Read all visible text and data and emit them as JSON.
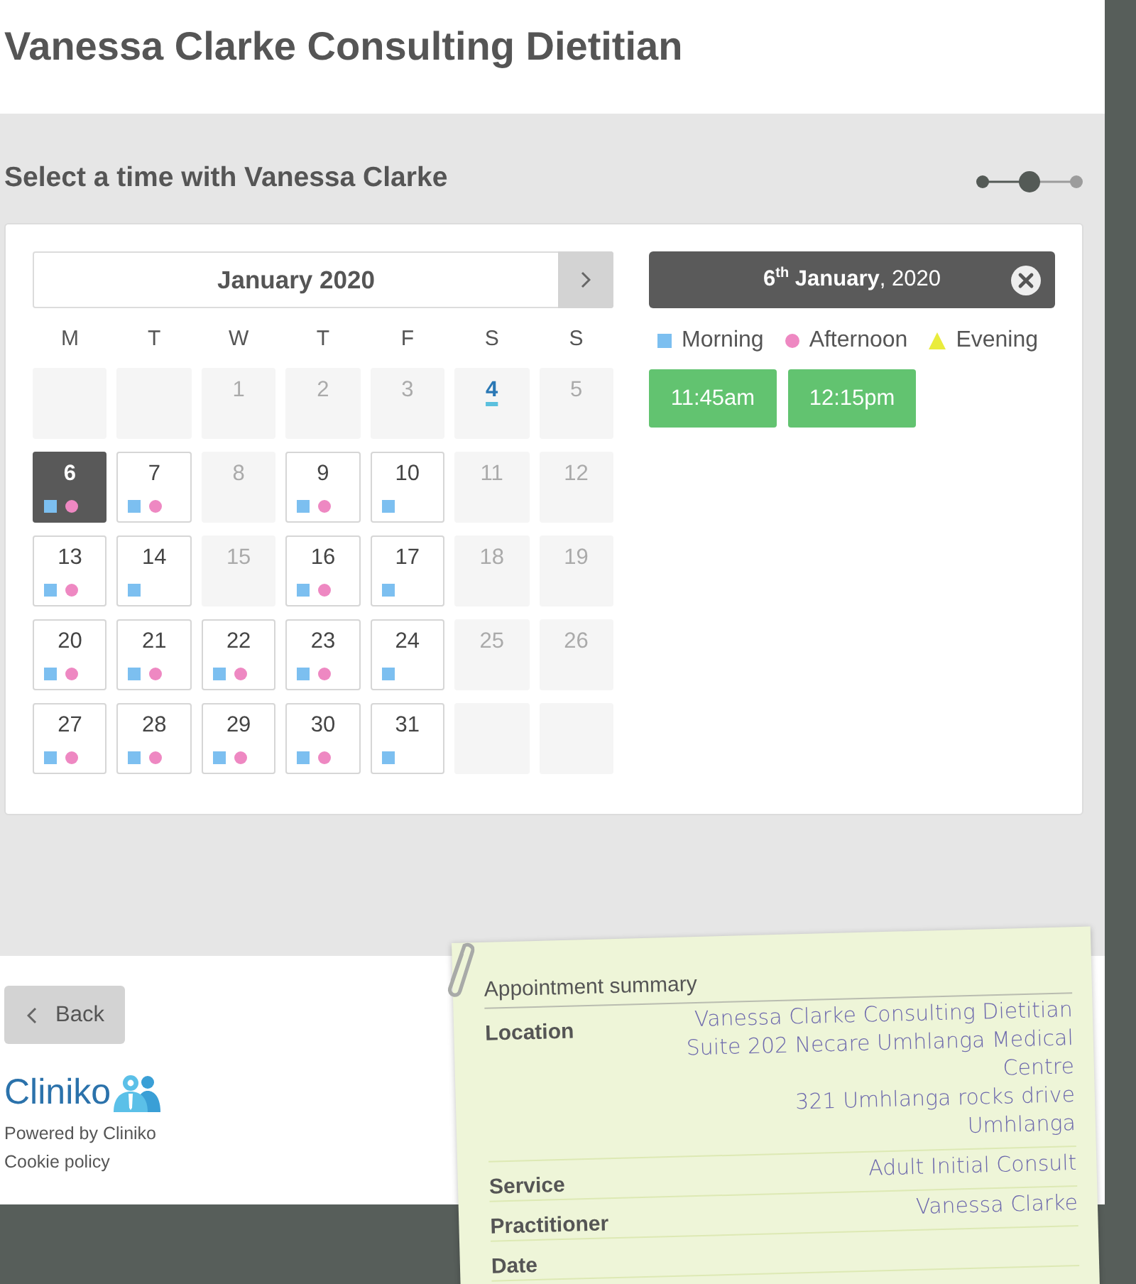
{
  "header": {
    "title": "Vanessa Clarke Consulting Dietitian"
  },
  "booking": {
    "heading": "Select a time with Vanessa Clarke",
    "steps": [
      {
        "completed": true,
        "selected": false
      },
      {
        "completed": false,
        "selected": true
      },
      {
        "completed": false,
        "selected": false
      }
    ]
  },
  "calendar": {
    "month": "January 2020",
    "weekdays": [
      "M",
      "T",
      "W",
      "T",
      "F",
      "S",
      "S"
    ],
    "days": [
      {
        "kind": "blank"
      },
      {
        "kind": "blank"
      },
      {
        "kind": "day",
        "label": "1",
        "available": false,
        "selected": false,
        "today": false,
        "morning": false,
        "afternoon": false
      },
      {
        "kind": "day",
        "label": "2",
        "available": false,
        "selected": false,
        "today": false,
        "morning": false,
        "afternoon": false
      },
      {
        "kind": "day",
        "label": "3",
        "available": false,
        "selected": false,
        "today": false,
        "morning": false,
        "afternoon": false
      },
      {
        "kind": "day",
        "label": "4",
        "available": false,
        "selected": false,
        "today": true,
        "morning": false,
        "afternoon": false
      },
      {
        "kind": "day",
        "label": "5",
        "available": false,
        "selected": false,
        "today": false,
        "morning": false,
        "afternoon": false
      },
      {
        "kind": "day",
        "label": "6",
        "available": true,
        "selected": true,
        "today": false,
        "morning": true,
        "afternoon": true
      },
      {
        "kind": "day",
        "label": "7",
        "available": true,
        "selected": false,
        "today": false,
        "morning": true,
        "afternoon": true
      },
      {
        "kind": "day",
        "label": "8",
        "available": false,
        "selected": false,
        "today": false,
        "morning": false,
        "afternoon": false
      },
      {
        "kind": "day",
        "label": "9",
        "available": true,
        "selected": false,
        "today": false,
        "morning": true,
        "afternoon": true
      },
      {
        "kind": "day",
        "label": "10",
        "available": true,
        "selected": false,
        "today": false,
        "morning": true,
        "afternoon": false
      },
      {
        "kind": "day",
        "label": "11",
        "available": false,
        "selected": false,
        "today": false,
        "morning": false,
        "afternoon": false
      },
      {
        "kind": "day",
        "label": "12",
        "available": false,
        "selected": false,
        "today": false,
        "morning": false,
        "afternoon": false
      },
      {
        "kind": "day",
        "label": "13",
        "available": true,
        "selected": false,
        "today": false,
        "morning": true,
        "afternoon": true
      },
      {
        "kind": "day",
        "label": "14",
        "available": true,
        "selected": false,
        "today": false,
        "morning": true,
        "afternoon": false
      },
      {
        "kind": "day",
        "label": "15",
        "available": false,
        "selected": false,
        "today": false,
        "morning": false,
        "afternoon": false
      },
      {
        "kind": "day",
        "label": "16",
        "available": true,
        "selected": false,
        "today": false,
        "morning": true,
        "afternoon": true
      },
      {
        "kind": "day",
        "label": "17",
        "available": true,
        "selected": false,
        "today": false,
        "morning": true,
        "afternoon": false
      },
      {
        "kind": "day",
        "label": "18",
        "available": false,
        "selected": false,
        "today": false,
        "morning": false,
        "afternoon": false
      },
      {
        "kind": "day",
        "label": "19",
        "available": false,
        "selected": false,
        "today": false,
        "morning": false,
        "afternoon": false
      },
      {
        "kind": "day",
        "label": "20",
        "available": true,
        "selected": false,
        "today": false,
        "morning": true,
        "afternoon": true
      },
      {
        "kind": "day",
        "label": "21",
        "available": true,
        "selected": false,
        "today": false,
        "morning": true,
        "afternoon": true
      },
      {
        "kind": "day",
        "label": "22",
        "available": true,
        "selected": false,
        "today": false,
        "morning": true,
        "afternoon": true
      },
      {
        "kind": "day",
        "label": "23",
        "available": true,
        "selected": false,
        "today": false,
        "morning": true,
        "afternoon": true
      },
      {
        "kind": "day",
        "label": "24",
        "available": true,
        "selected": false,
        "today": false,
        "morning": true,
        "afternoon": false
      },
      {
        "kind": "day",
        "label": "25",
        "available": false,
        "selected": false,
        "today": false,
        "morning": false,
        "afternoon": false
      },
      {
        "kind": "day",
        "label": "26",
        "available": false,
        "selected": false,
        "today": false,
        "morning": false,
        "afternoon": false
      },
      {
        "kind": "day",
        "label": "27",
        "available": true,
        "selected": false,
        "today": false,
        "morning": true,
        "afternoon": true
      },
      {
        "kind": "day",
        "label": "28",
        "available": true,
        "selected": false,
        "today": false,
        "morning": true,
        "afternoon": true
      },
      {
        "kind": "day",
        "label": "29",
        "available": true,
        "selected": false,
        "today": false,
        "morning": true,
        "afternoon": true
      },
      {
        "kind": "day",
        "label": "30",
        "available": true,
        "selected": false,
        "today": false,
        "morning": true,
        "afternoon": true
      },
      {
        "kind": "day",
        "label": "31",
        "available": true,
        "selected": false,
        "today": false,
        "morning": true,
        "afternoon": false
      },
      {
        "kind": "blank"
      },
      {
        "kind": "blank"
      }
    ]
  },
  "selection": {
    "date": "**6$^{th}$ January**, 2020",
    "legend": [
      {
        "label": "Morning",
        "kind": "square",
        "color": "#7cbff0"
      },
      {
        "label": "Afternoon",
        "kind": "circle",
        "color": "#ee88c2"
      },
      {
        "label": "Evening",
        "kind": "triangle",
        "color": "#e9ec3c"
      }
    ],
    "times": [
      "11:45am",
      "12:15pm"
    ]
  },
  "footer": {
    "back": "Back",
    "brand": "Cliniko",
    "powered_by": "Powered by Cliniko",
    "cookie_policy": "Cookie policy"
  },
  "summary": {
    "title": "Appointment summary",
    "rows": [
      {
        "label": "Location",
        "values": [
          "Vanessa Clarke Consulting Dietitian",
          "Suite 202 Necare Umhlanga Medical Centre",
          "321 Umhlanga rocks drive",
          "Umhlanga"
        ]
      },
      {
        "label": "Service",
        "values": [
          "Adult Initial Consult"
        ]
      },
      {
        "label": "Practitioner",
        "values": [
          "Vanessa Clarke"
        ]
      },
      {
        "label": "Date"
      }
    ]
  }
}
